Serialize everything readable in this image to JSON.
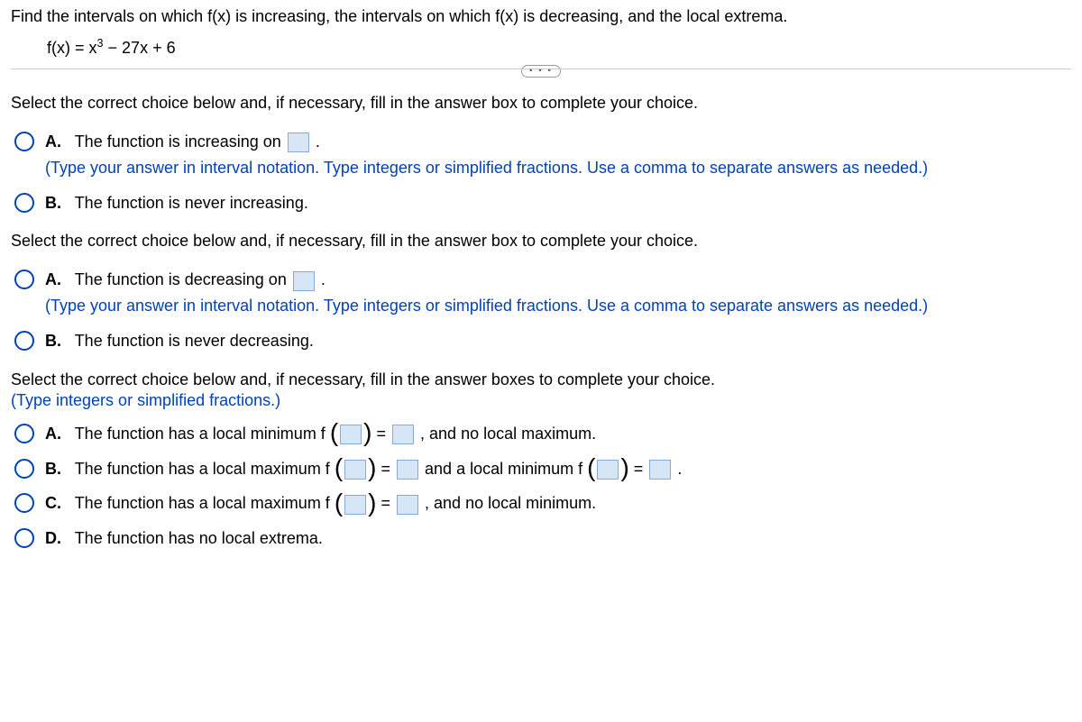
{
  "question": "Find the intervals on which f(x) is increasing, the intervals on which f(x) is decreasing, and the local extrema.",
  "equation_prefix": "f(x) = x",
  "equation_exp": "3",
  "equation_suffix": " − 27x + 6",
  "sections": {
    "s1": {
      "prompt": "Select the correct choice below and, if necessary, fill in the answer box to complete your choice.",
      "A": {
        "label": "A.",
        "text_before": "The function is increasing on ",
        "text_after": ".",
        "hint": "(Type your answer in interval notation. Type integers or simplified fractions. Use a comma to separate answers as needed.)"
      },
      "B": {
        "label": "B.",
        "text": "The function is never increasing."
      }
    },
    "s2": {
      "prompt": "Select the correct choice below and, if necessary, fill in the answer box to complete your choice.",
      "A": {
        "label": "A.",
        "text_before": "The function is decreasing on ",
        "text_after": ".",
        "hint": "(Type your answer in interval notation. Type integers or simplified fractions. Use a comma to separate answers as needed.)"
      },
      "B": {
        "label": "B.",
        "text": "The function is never decreasing."
      }
    },
    "s3": {
      "prompt": "Select the correct choice below and, if necessary, fill in the answer boxes to complete your choice.",
      "hint": "(Type integers or simplified fractions.)",
      "A": {
        "label": "A.",
        "t1": "The function has a local minimum f",
        "eq": " = ",
        "t2": ", and no local maximum."
      },
      "B": {
        "label": "B.",
        "t1": "The function has a local maximum f",
        "eq1": " = ",
        "t2": " and a local minimum f",
        "eq2": " = ",
        "t3": "."
      },
      "C": {
        "label": "C.",
        "t1": "The function has a local maximum f",
        "eq": " = ",
        "t2": ", and no local minimum."
      },
      "D": {
        "label": "D.",
        "text": "The function has no local extrema."
      }
    }
  },
  "dots": "• • •"
}
